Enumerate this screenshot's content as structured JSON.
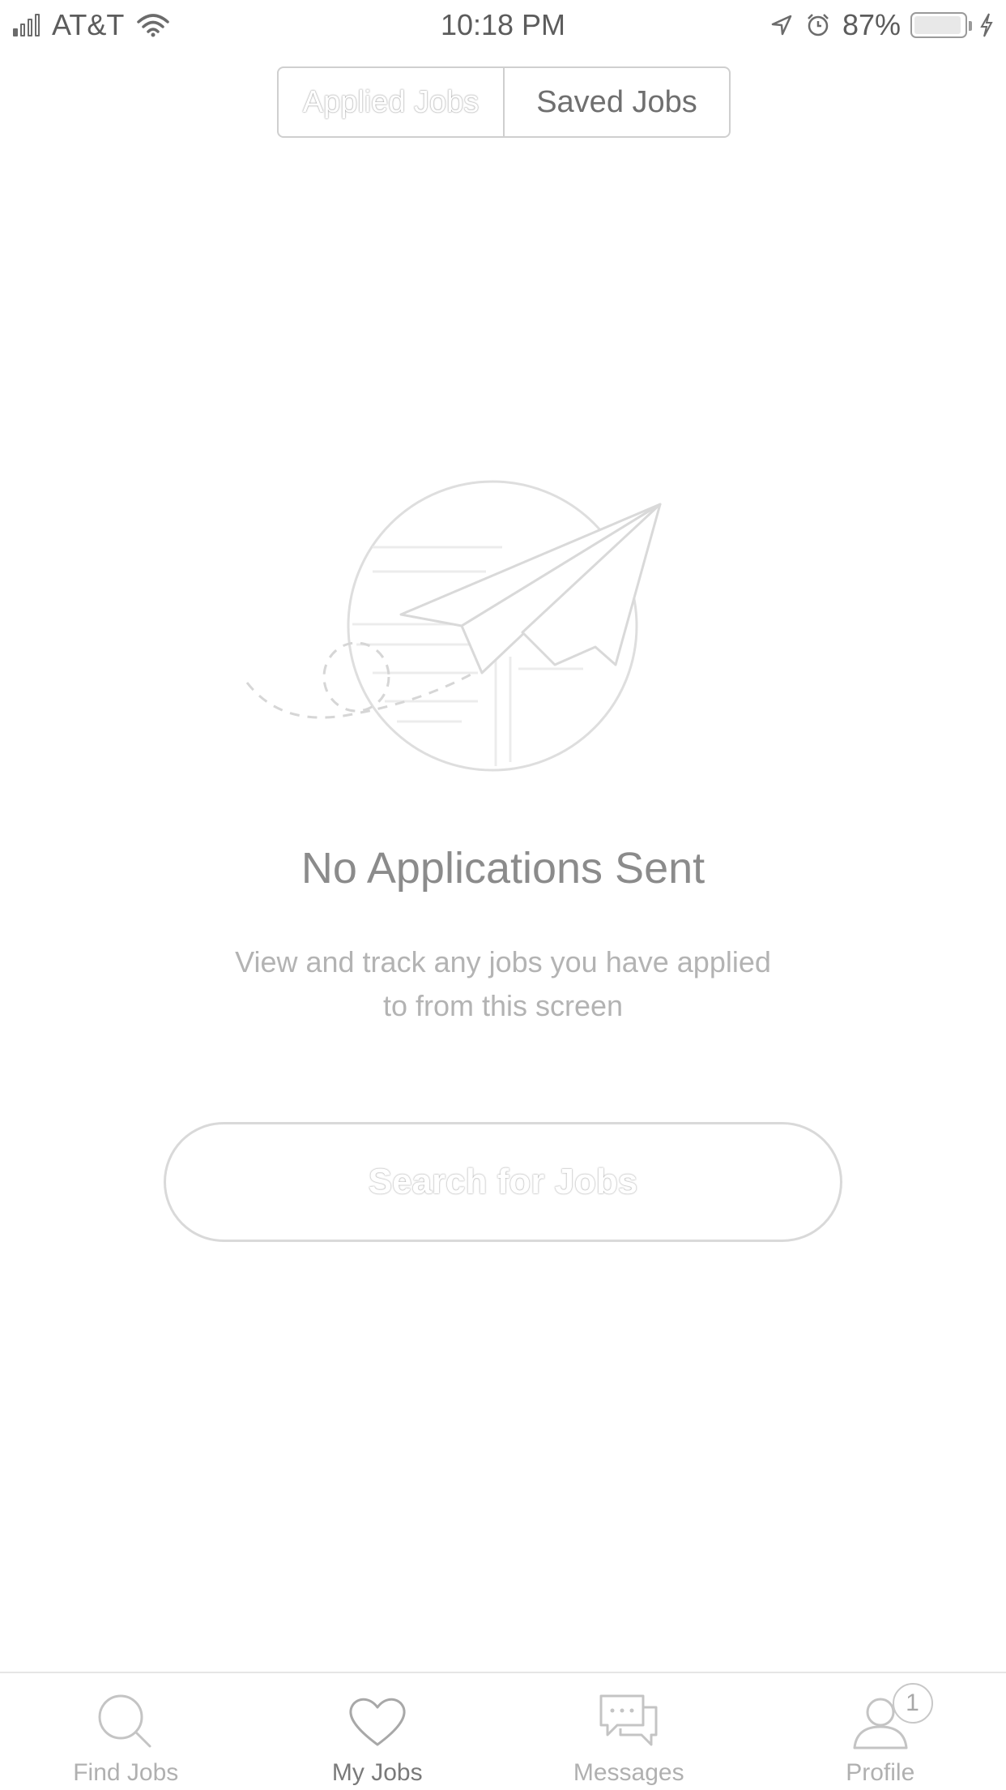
{
  "status_bar": {
    "carrier": "AT&T",
    "time": "10:18 PM",
    "battery_percent": "87%",
    "battery_level": 0.87,
    "icons": [
      "signal-icon",
      "wifi-icon",
      "location-arrow-icon",
      "alarm-icon",
      "battery-icon",
      "charging-bolt-icon"
    ]
  },
  "segmented_control": {
    "tabs": [
      {
        "label": "Applied Jobs",
        "selected": true
      },
      {
        "label": "Saved Jobs",
        "selected": false
      }
    ]
  },
  "empty_state": {
    "illustration": "paper-plane-illustration",
    "title": "No Applications Sent",
    "description_line1": "View and track any jobs you have applied",
    "description_line2": "to from this screen",
    "button_label": "Search for Jobs"
  },
  "tab_bar": {
    "items": [
      {
        "label": "Find Jobs",
        "icon": "search-icon",
        "active": false
      },
      {
        "label": "My Jobs",
        "icon": "heart-icon",
        "active": true
      },
      {
        "label": "Messages",
        "icon": "messages-icon",
        "active": false
      },
      {
        "label": "Profile",
        "icon": "profile-icon",
        "active": false,
        "badge": "1"
      }
    ]
  },
  "colors": {
    "text_primary": "#8b8b8b",
    "text_secondary": "#b3b3b3",
    "border": "#d9d9d9",
    "background": "#ffffff"
  }
}
